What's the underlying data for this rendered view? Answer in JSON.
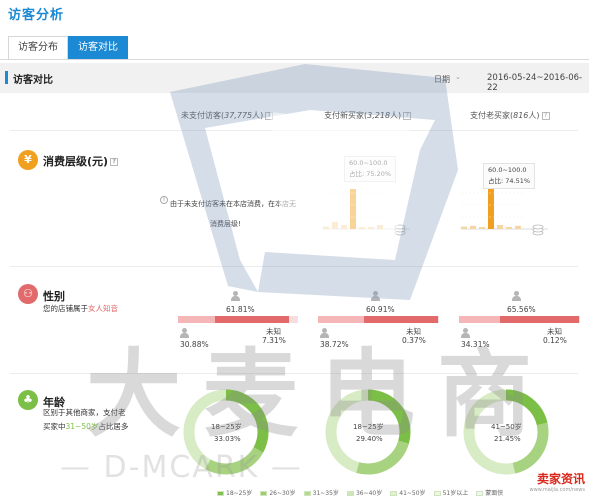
{
  "header": {
    "title": "访客分析"
  },
  "tabs": [
    {
      "label": "访客分布",
      "active": false
    },
    {
      "label": "访客对比",
      "active": true
    }
  ],
  "section": {
    "title": "访客对比",
    "date_label": "日期",
    "date_range": "2016-05-24~2016-06-22"
  },
  "columns": [
    {
      "prefix": "未支付访客(",
      "count": "37,775",
      "suffix": "人)"
    },
    {
      "prefix": "支付新买家(",
      "count": "3,218",
      "suffix": "人)"
    },
    {
      "prefix": "支付老买家(",
      "count": "816",
      "suffix": "人)"
    }
  ],
  "spend": {
    "label": "消费层级(元)",
    "icon": "yen-icon",
    "note_line1": "由于未支付访客未在本店消费，在本店无",
    "note_line2": "消费层级!",
    "tooltips": [
      {
        "range": "60.0~100.0",
        "share": "占比: 75.20%"
      },
      {
        "range": "60.0~100.0",
        "share": "占比: 74.51%"
      }
    ],
    "bars": [
      [
        0.06,
        0.18,
        0.1,
        1.0,
        0.04,
        0.02,
        0.1
      ],
      [
        0.06,
        0.08,
        0.05,
        1.0,
        0.1,
        0.02,
        0.08
      ]
    ]
  },
  "gender": {
    "label": "性别",
    "icon": "people-icon",
    "desc_prefix": "您的店铺属于",
    "desc_highlight": "女人知音",
    "groups": [
      {
        "female": "61.81%",
        "male": "30.88%",
        "unknown_label": "未知",
        "unknown": "7.31%",
        "female_v": 61.81,
        "male_v": 30.88,
        "unknown_v": 7.31
      },
      {
        "female": "60.91%",
        "male": "38.72%",
        "unknown_label": "未知",
        "unknown": "0.37%",
        "female_v": 60.91,
        "male_v": 38.72,
        "unknown_v": 0.37
      },
      {
        "female": "65.56%",
        "male": "34.31%",
        "unknown_label": "未知",
        "unknown": "0.12%",
        "female_v": 65.56,
        "male_v": 34.31,
        "unknown_v": 0.12
      }
    ]
  },
  "age": {
    "label": "年龄",
    "icon": "tree-icon",
    "desc_line1": "区别于其他商家，支付老",
    "desc_line2_prefix": "买家中",
    "desc_line2_highlight": "31~50岁",
    "desc_line2_suffix": "占比居多",
    "donuts": [
      {
        "range": "18~25岁",
        "share": "33.03%",
        "value": 33.03
      },
      {
        "range": "18~25岁",
        "share": "29.40%",
        "value": 29.4
      },
      {
        "range": "41~50岁",
        "share": "21.45%",
        "value": 21.45
      }
    ]
  },
  "legend": [
    {
      "label": "18~25岁",
      "color": "#7fbf4d"
    },
    {
      "label": "26~30岁",
      "color": "#9ccd6e"
    },
    {
      "label": "31~35岁",
      "color": "#b5da8f"
    },
    {
      "label": "36~40岁",
      "color": "#cde6b3"
    },
    {
      "label": "41~50岁",
      "color": "#e2f0d3"
    },
    {
      "label": "51岁以上",
      "color": "#eef6e6"
    },
    {
      "label": "蒙面侠",
      "color": "#f4f4f4"
    }
  ],
  "watermark": {
    "big": "大麦电商",
    "sub": "— D-MCARK —"
  },
  "corner_logo": {
    "name": "卖家资讯",
    "url": "www.maijia.com/news"
  },
  "colors": {
    "brand": "#1c89d4",
    "female": "#e26a6a",
    "female_light": "#f4b6b6",
    "male": "#d8d8d8",
    "spend": "#f0a01e",
    "age": "#7cbf47"
  }
}
